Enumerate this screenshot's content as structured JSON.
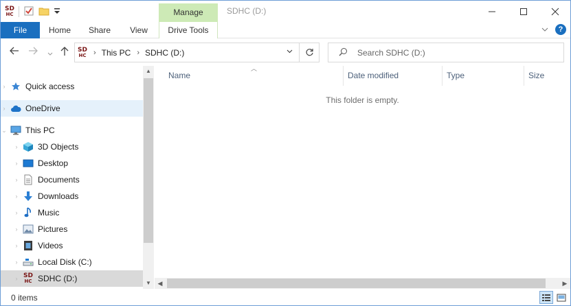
{
  "window": {
    "title": "SDHC (D:)",
    "contextual_tab_group": "Manage"
  },
  "ribbon": {
    "tabs": [
      "File",
      "Home",
      "Share",
      "View",
      "Drive Tools"
    ],
    "file_tab_color": "#1a6fbf",
    "manage_color": "#cdeab6"
  },
  "address": {
    "root_icon": "sdhc-drive-icon",
    "breadcrumbs": [
      "This PC",
      "SDHC (D:)"
    ]
  },
  "search": {
    "placeholder": "Search SDHC (D:)"
  },
  "nav": {
    "items": [
      {
        "label": "Quick access",
        "icon": "star-icon"
      },
      {
        "label": "OneDrive",
        "icon": "cloud-icon"
      },
      {
        "label": "This PC",
        "icon": "computer-icon"
      },
      {
        "label": "3D Objects",
        "icon": "cube-icon"
      },
      {
        "label": "Desktop",
        "icon": "desktop-icon"
      },
      {
        "label": "Documents",
        "icon": "document-icon"
      },
      {
        "label": "Downloads",
        "icon": "download-icon"
      },
      {
        "label": "Music",
        "icon": "music-icon"
      },
      {
        "label": "Pictures",
        "icon": "picture-icon"
      },
      {
        "label": "Videos",
        "icon": "video-icon"
      },
      {
        "label": "Local Disk (C:)",
        "icon": "local-disk-icon"
      },
      {
        "label": "SDHC (D:)",
        "icon": "sdhc-drive-icon"
      }
    ]
  },
  "content": {
    "columns": [
      "Name",
      "Date modified",
      "Type",
      "Size"
    ],
    "empty_message": "This folder is empty."
  },
  "status": {
    "item_count": "0 items"
  }
}
